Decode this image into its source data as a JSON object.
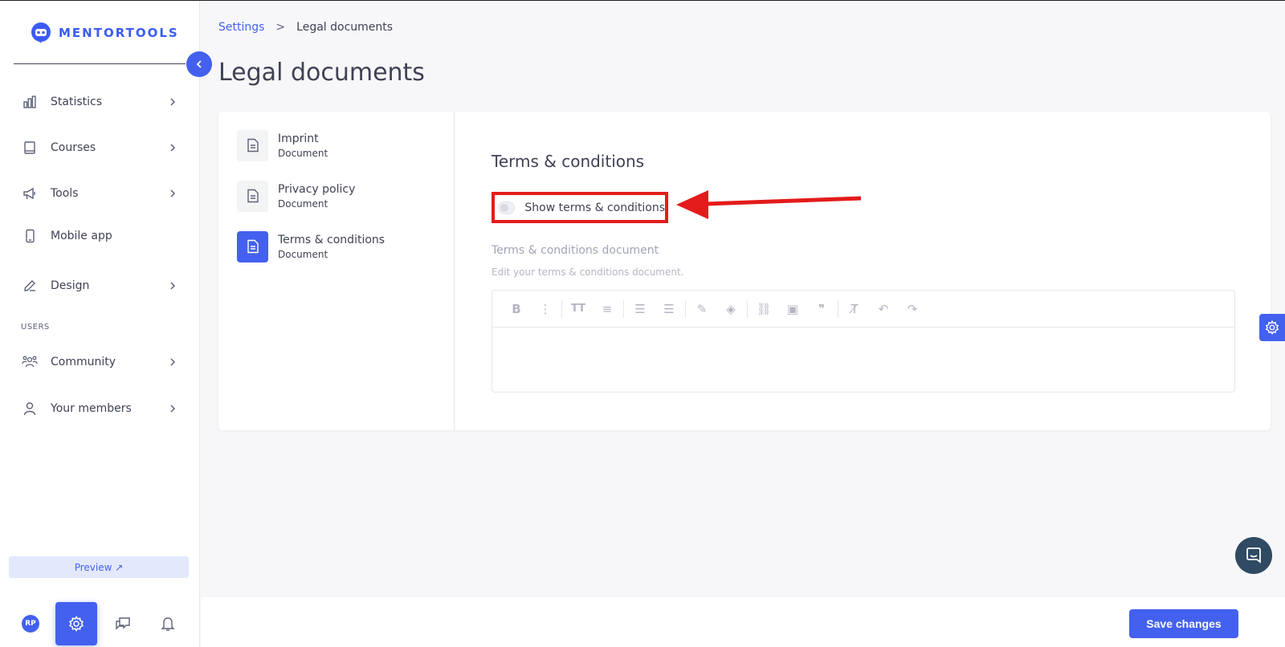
{
  "app": {
    "logo_text": "MENTORTOOLS",
    "accent": "#4361ee",
    "annotation_color": "#e41b1b"
  },
  "sidebar": {
    "items": [
      {
        "label": "Statistics",
        "icon": "bar-chart-icon",
        "has_chevron": true
      },
      {
        "label": "Courses",
        "icon": "book-icon",
        "has_chevron": true
      },
      {
        "label": "Tools",
        "icon": "megaphone-icon",
        "has_chevron": true
      },
      {
        "label": "Mobile app",
        "icon": "phone-icon",
        "has_chevron": false
      },
      {
        "label": "Design",
        "icon": "edit-icon",
        "has_chevron": true
      }
    ],
    "users_section_label": "USERS",
    "user_items": [
      {
        "label": "Community",
        "icon": "community-icon",
        "has_chevron": true
      },
      {
        "label": "Your members",
        "icon": "user-icon",
        "has_chevron": true
      }
    ],
    "preview_label": "Preview ↗",
    "avatar_initials": "RP"
  },
  "breadcrumb": {
    "parent": "Settings",
    "separator": ">",
    "current": "Legal documents"
  },
  "page_title": "Legal documents",
  "documents": [
    {
      "title": "Imprint",
      "subtitle": "Document",
      "active": false
    },
    {
      "title": "Privacy policy",
      "subtitle": "Document",
      "active": false
    },
    {
      "title": "Terms & conditions",
      "subtitle": "Document",
      "active": true
    }
  ],
  "editor_section": {
    "title": "Terms & conditions",
    "toggle_label": "Show terms & conditions",
    "toggle_on": false,
    "field_label": "Terms & conditions document",
    "field_help": "Edit your terms & conditions document."
  },
  "toolbar": {
    "bold": "B",
    "more": "⋮",
    "font_size": "TT",
    "align": "≡",
    "ul": "☰",
    "ol": "☰",
    "brush": "✎",
    "fill": "◈",
    "link": "⛓",
    "image": "▣",
    "quote": "❞",
    "clear": "T̸",
    "undo": "↶",
    "redo": "↷"
  },
  "footer": {
    "save_label": "Save changes"
  }
}
